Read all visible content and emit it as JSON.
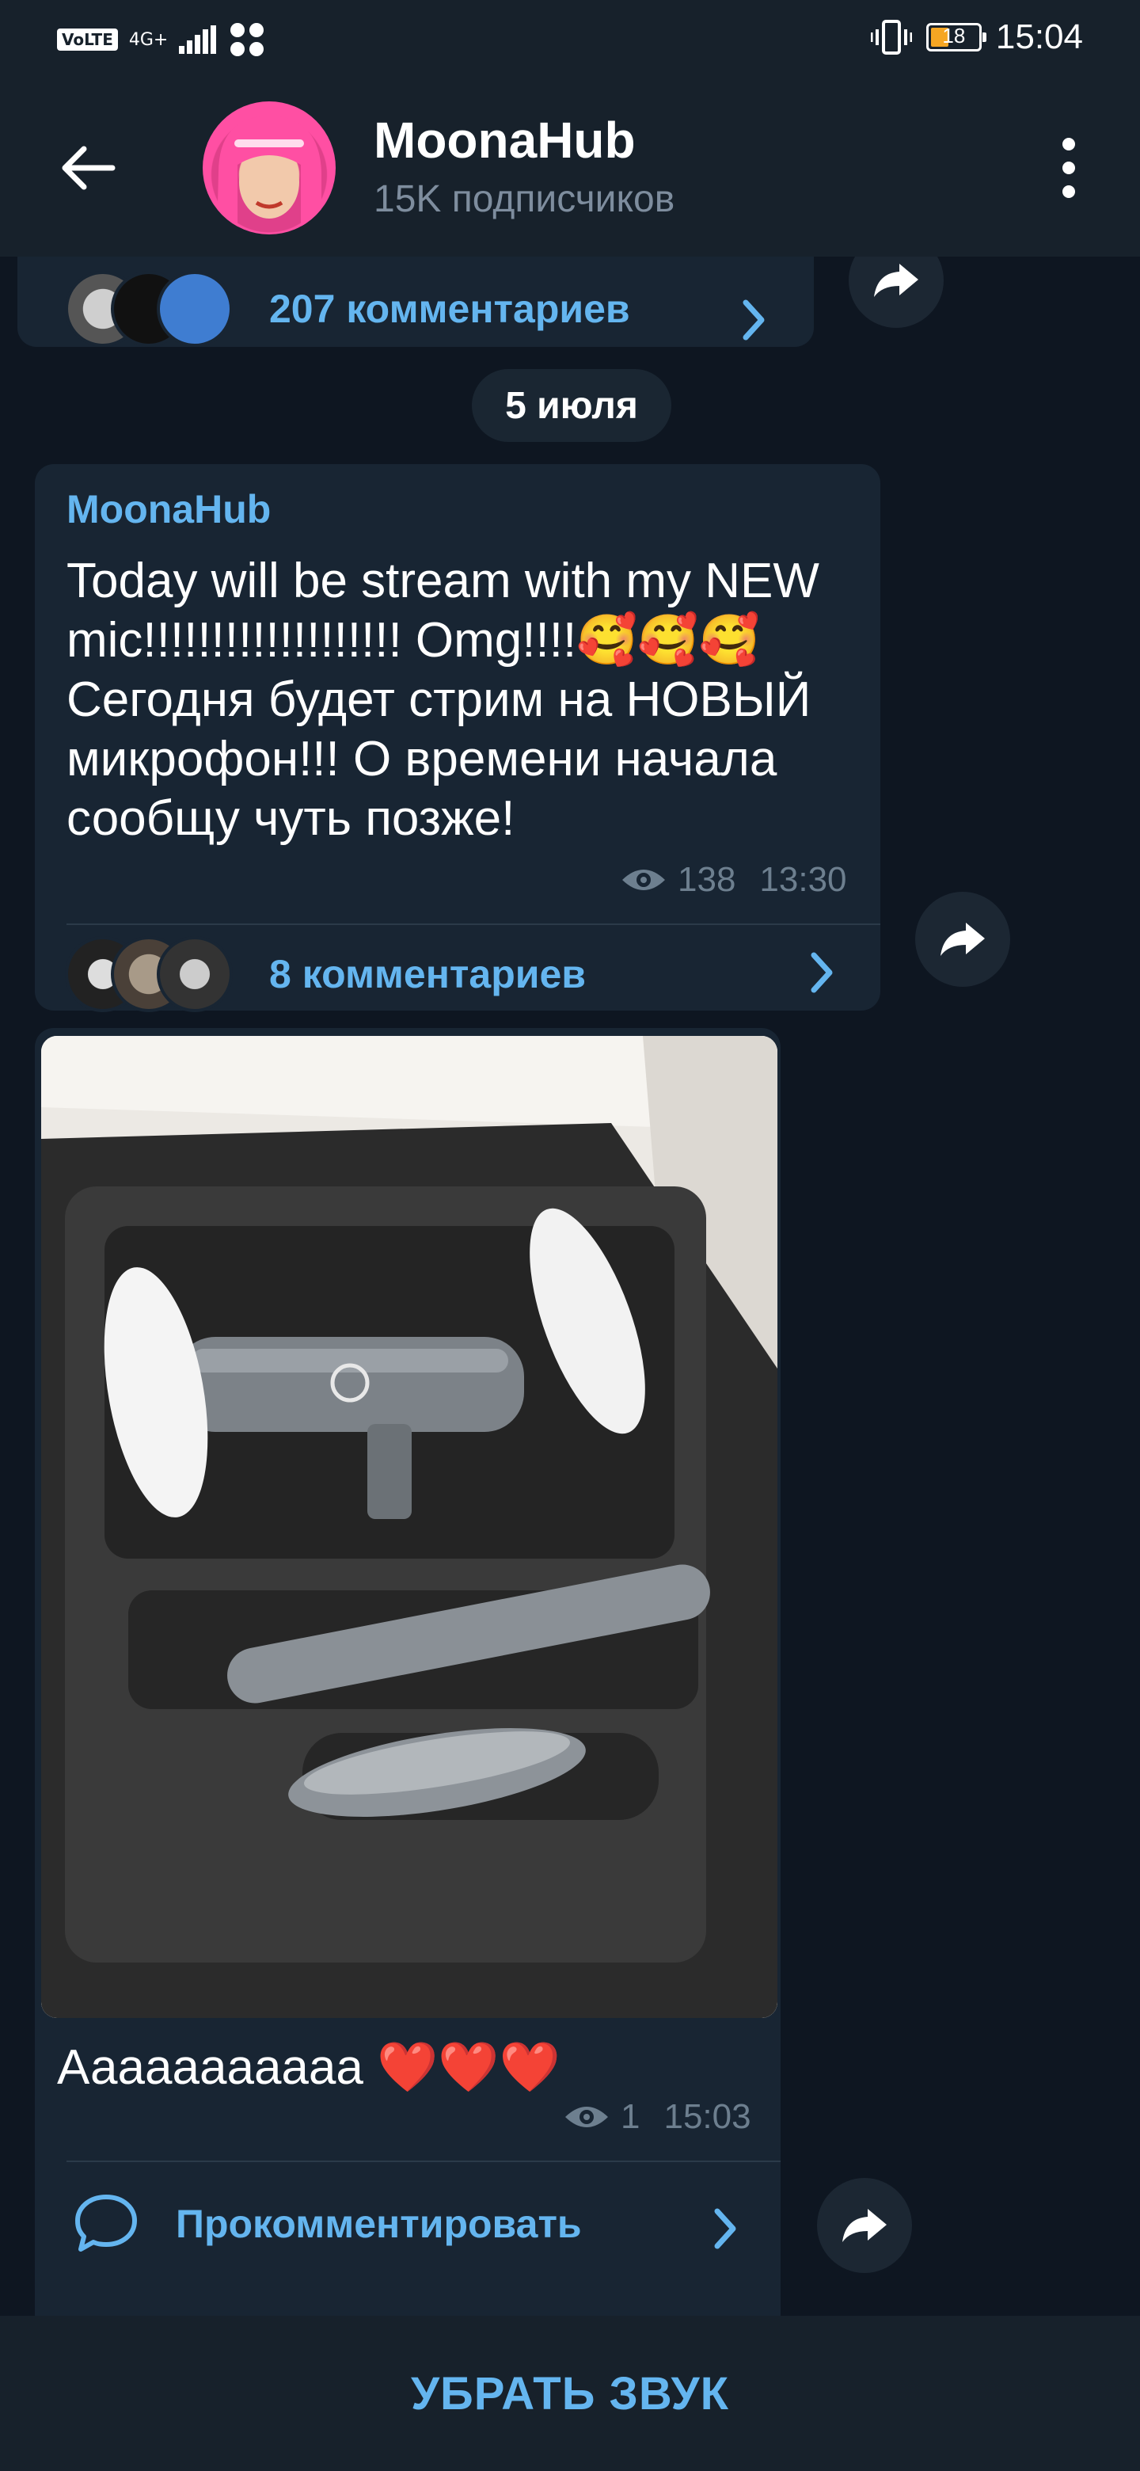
{
  "status_bar": {
    "volte": "VoLTE",
    "network": "4G+",
    "battery": "18",
    "time": "15:04"
  },
  "header": {
    "title": "MoonaHub",
    "subtitle": "15K подписчиков"
  },
  "posts": [
    {
      "comments_label": "207 комментариев"
    },
    {
      "date": "5 июля",
      "author": "MoonaHub",
      "text": "Today will be stream with my NEW mic!!!!!!!!!!!!!!!!!!! Omg!!!!🥰🥰🥰\nСегодня будет стрим на НОВЫЙ микрофон!!! О времени начала сообщу чуть позже!",
      "views": "138",
      "time": "13:30",
      "comments_label": "8 комментариев"
    },
    {
      "caption": "Ааааааааааа ❤️❤️❤️",
      "views": "1",
      "time": "15:03",
      "comment_label": "Прокомментировать"
    }
  ],
  "bottom_bar": {
    "mute_label": "УБРАТЬ ЗВУК"
  },
  "colors": {
    "accent": "#64b5ef",
    "header_bg": "#17212b",
    "chat_bg": "#0e1621",
    "bubble_bg": "#182533"
  },
  "icons": [
    "back-arrow-icon",
    "more-vert-icon",
    "eye-icon",
    "chevron-right-icon",
    "share-icon",
    "comment-bubble-icon"
  ]
}
